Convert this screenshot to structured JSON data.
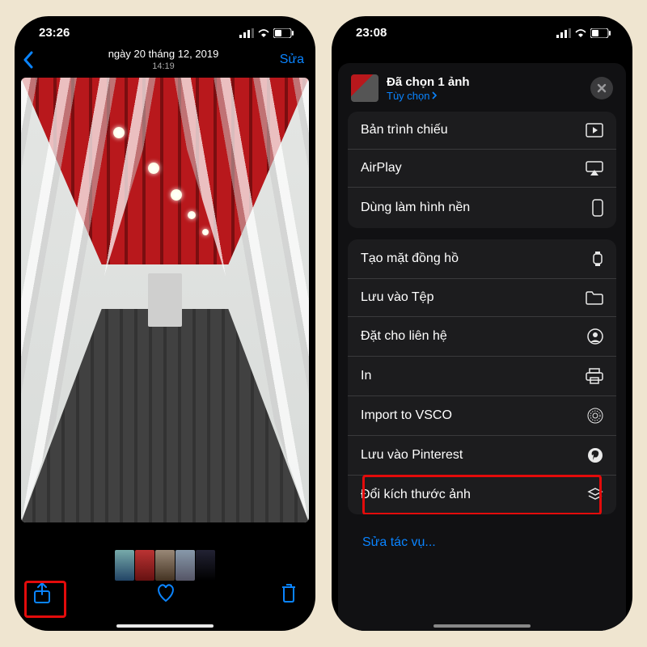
{
  "left": {
    "status": {
      "time": "23:26"
    },
    "nav": {
      "title": "ngày 20 tháng 12, 2019",
      "subtitle": "14:19",
      "edit": "Sửa"
    }
  },
  "right": {
    "status": {
      "time": "23:08"
    },
    "sheet": {
      "title": "Đã chọn 1 ảnh",
      "options": "Tùy chọn",
      "group1": [
        {
          "label": "Bản trình chiếu",
          "icon": "play"
        },
        {
          "label": "AirPlay",
          "icon": "airplay"
        },
        {
          "label": "Dùng làm hình nền",
          "icon": "phone"
        }
      ],
      "group2": [
        {
          "label": "Tạo mặt đồng hồ",
          "icon": "watch"
        },
        {
          "label": "Lưu vào Tệp",
          "icon": "folder"
        },
        {
          "label": "Đặt cho liên hệ",
          "icon": "contact"
        },
        {
          "label": "In",
          "icon": "print"
        },
        {
          "label": "Import to VSCO",
          "icon": "vsco"
        },
        {
          "label": "Lưu vào Pinterest",
          "icon": "pinterest"
        },
        {
          "label": "Đổi kích thước ảnh",
          "icon": "stack"
        }
      ],
      "edit_actions": "Sửa tác vụ..."
    }
  }
}
